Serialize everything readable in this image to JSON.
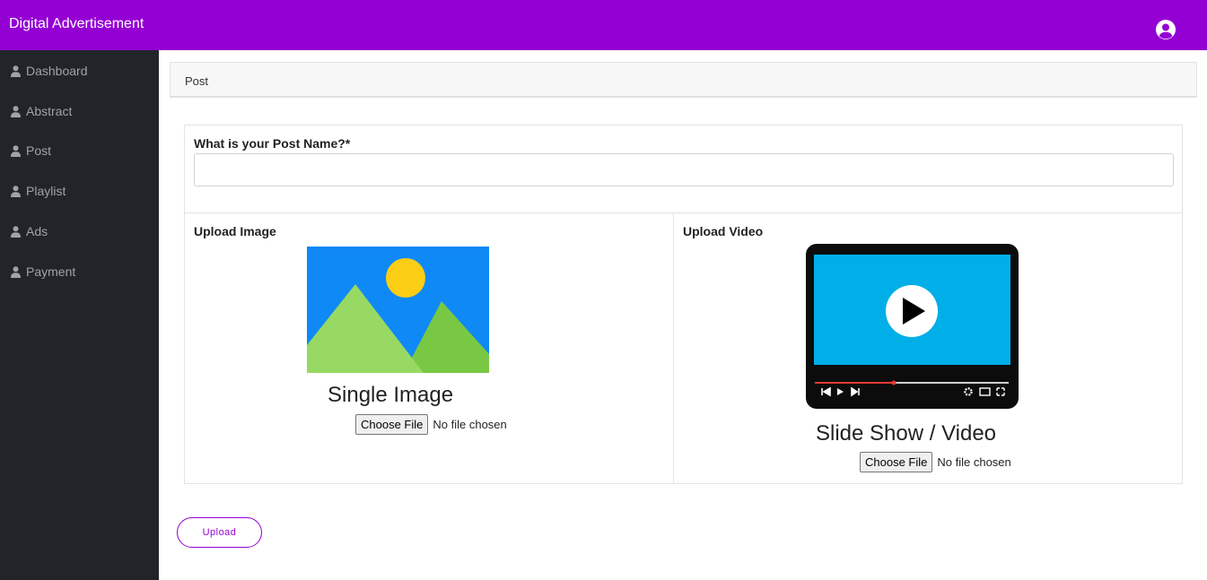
{
  "header": {
    "title": "Digital Advertisement",
    "avatar_icon": "user-circle-icon"
  },
  "sidebar": {
    "items": [
      {
        "label": "Dashboard",
        "icon": "user-icon"
      },
      {
        "label": "Abstract",
        "icon": "user-icon"
      },
      {
        "label": "Post",
        "icon": "user-icon"
      },
      {
        "label": "Playlist",
        "icon": "user-icon"
      },
      {
        "label": "Ads",
        "icon": "user-icon"
      },
      {
        "label": "Payment",
        "icon": "user-icon"
      }
    ]
  },
  "breadcrumb": {
    "current": "Post"
  },
  "form": {
    "name_label": "What is your Post Name?*",
    "name_value": "",
    "image": {
      "label": "Upload Image",
      "title": "Single Image",
      "choose_label": "Choose File",
      "status": "No file chosen"
    },
    "video": {
      "label": "Upload Video",
      "title": "Slide Show / Video",
      "choose_label": "Choose File",
      "status": "No file chosen"
    },
    "submit_label": "Upload"
  },
  "colors": {
    "accent": "#9400d3",
    "sidebar_bg": "#212529",
    "video_screen": "#00aee8",
    "image_sky": "#0f89f5"
  }
}
